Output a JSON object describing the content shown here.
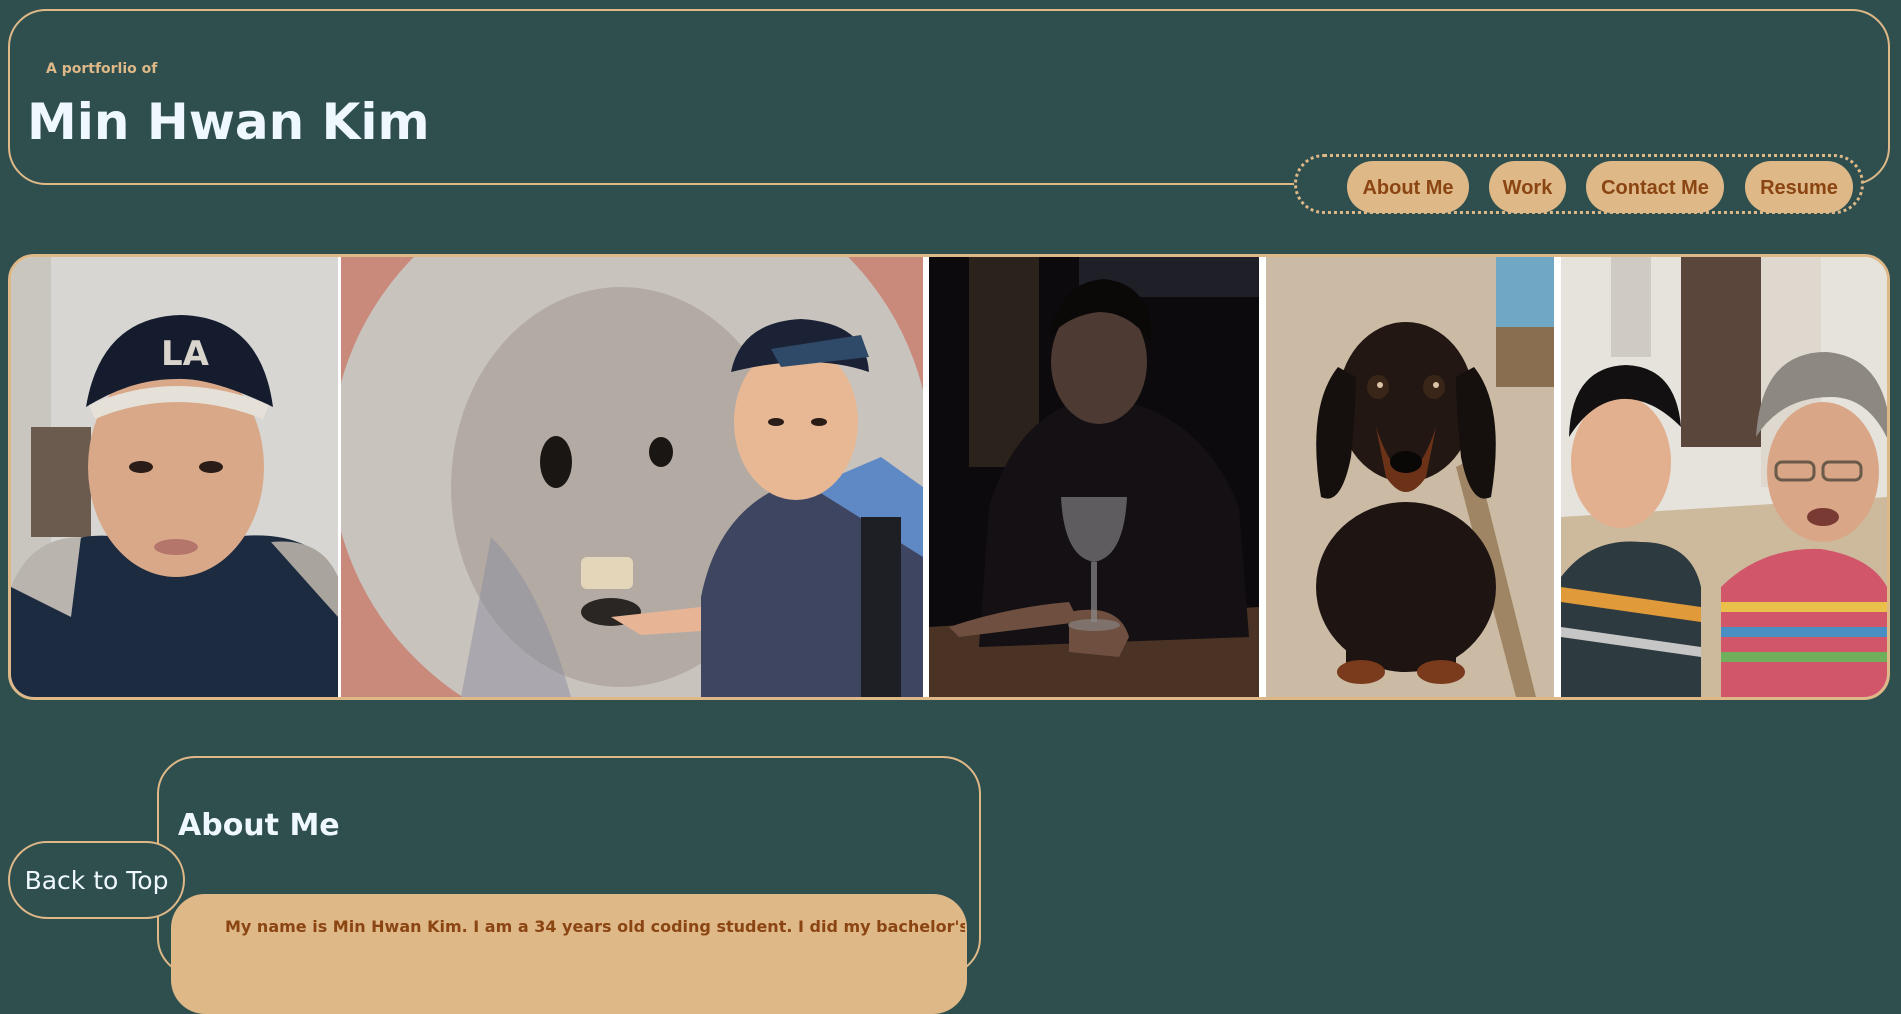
{
  "header": {
    "tagline": "A portforlio of",
    "title": "Min Hwan Kim"
  },
  "nav": {
    "items": [
      {
        "label": "About Me"
      },
      {
        "label": "Work"
      },
      {
        "label": "Contact Me"
      },
      {
        "label": "Resume"
      }
    ]
  },
  "gallery": {
    "photos": [
      {
        "subject": "selfie-with-la-cap"
      },
      {
        "subject": "mouth-of-truth-selfie"
      },
      {
        "subject": "holding-wine-glass"
      },
      {
        "subject": "dachshund-on-chair"
      },
      {
        "subject": "selfie-with-grandmother"
      }
    ]
  },
  "about": {
    "heading": "About Me",
    "text": "My name is Min Hwan Kim. I am a 34 years old coding student. I did my bachelor's degree in"
  },
  "back_to_top": {
    "label": "Back to Top"
  },
  "colors": {
    "background": "#2f4f4f",
    "accent": "#deb887",
    "button_text": "#8b4513",
    "heading_text": "#f0f8ff"
  }
}
